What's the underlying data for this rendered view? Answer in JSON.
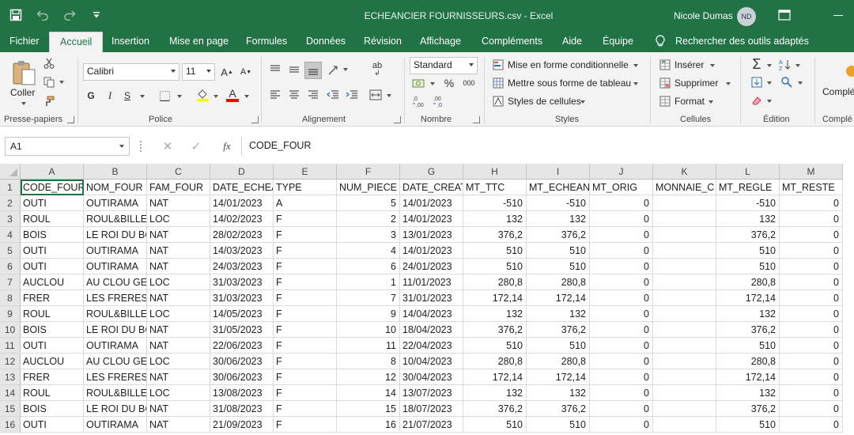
{
  "window": {
    "title": "ECHEANCIER FOURNISSEURS.csv  -  Excel",
    "user_name": "Nicole Dumas",
    "user_initials": "ND"
  },
  "ribbon_tabs": [
    "Fichier",
    "Accueil",
    "Insertion",
    "Mise en page",
    "Formules",
    "Données",
    "Révision",
    "Affichage",
    "Compléments",
    "Aide",
    "Équipe"
  ],
  "active_tab": "Accueil",
  "tell_me": "Rechercher des outils adaptés",
  "ribbon": {
    "clipboard": {
      "paste": "Coller",
      "label": "Presse-papiers"
    },
    "font": {
      "name": "Calibri",
      "size": "11",
      "bold": "G",
      "italic": "I",
      "underline": "S",
      "grow": "A",
      "shrink": "A",
      "fill_letter": "A",
      "label": "Police"
    },
    "alignment": {
      "label": "Alignement",
      "wrap": "ab"
    },
    "number": {
      "format": "Standard",
      "percent": "%",
      "thousands": "000",
      "inc_dec": ",0→,00",
      "dec_dec": ",00→,0",
      "label": "Nombre"
    },
    "styles": {
      "conditional": "Mise en forme conditionnelle",
      "table": "Mettre sous forme de tableau",
      "cell_styles": "Styles de cellules",
      "label": "Styles"
    },
    "cells": {
      "insert": "Insérer",
      "delete": "Supprimer",
      "format": "Format",
      "label": "Cellules"
    },
    "editing": {
      "sigma": "Σ",
      "label": "Édition"
    },
    "addins": {
      "label_top": "Complé",
      "label_bottom": "Complé"
    }
  },
  "formula_bar": {
    "name_box": "A1",
    "fx": "fx",
    "content": "CODE_FOUR"
  },
  "sheet": {
    "columns": [
      "A",
      "B",
      "C",
      "D",
      "E",
      "F",
      "G",
      "H",
      "I",
      "J",
      "K",
      "L",
      "M"
    ],
    "rows": [
      [
        "CODE_FOUR",
        "NOM_FOUR",
        "FAM_FOUR",
        "DATE_ECHEA",
        "TYPE",
        "NUM_PIECE",
        "DATE_CREAT",
        "MT_TTC",
        "MT_ECHEAN",
        "MT_ORIG",
        "MONNAIE_C",
        "MT_REGLE",
        "MT_RESTE"
      ],
      [
        "OUTI",
        "OUTIRAMA",
        "NAT",
        "14/01/2023",
        "A",
        "5",
        "14/01/2023",
        "-510",
        "-510",
        "0",
        "",
        "-510",
        "0"
      ],
      [
        "ROUL",
        "ROUL&BILLE",
        "LOC",
        "14/02/2023",
        "F",
        "2",
        "14/01/2023",
        "132",
        "132",
        "0",
        "",
        "132",
        "0"
      ],
      [
        "BOIS",
        "LE ROI DU BC",
        "NAT",
        "28/02/2023",
        "F",
        "3",
        "13/01/2023",
        "376,2",
        "376,2",
        "0",
        "",
        "376,2",
        "0"
      ],
      [
        "OUTI",
        "OUTIRAMA",
        "NAT",
        "14/03/2023",
        "F",
        "4",
        "14/01/2023",
        "510",
        "510",
        "0",
        "",
        "510",
        "0"
      ],
      [
        "OUTI",
        "OUTIRAMA",
        "NAT",
        "24/03/2023",
        "F",
        "6",
        "24/01/2023",
        "510",
        "510",
        "0",
        "",
        "510",
        "0"
      ],
      [
        "AUCLOU",
        "AU CLOU GEA",
        "LOC",
        "31/03/2023",
        "F",
        "1",
        "11/01/2023",
        "280,8",
        "280,8",
        "0",
        "",
        "280,8",
        "0"
      ],
      [
        "FRER",
        "LES FRERES L",
        "NAT",
        "31/03/2023",
        "F",
        "7",
        "31/01/2023",
        "172,14",
        "172,14",
        "0",
        "",
        "172,14",
        "0"
      ],
      [
        "ROUL",
        "ROUL&BILLE",
        "LOC",
        "14/05/2023",
        "F",
        "9",
        "14/04/2023",
        "132",
        "132",
        "0",
        "",
        "132",
        "0"
      ],
      [
        "BOIS",
        "LE ROI DU BC",
        "NAT",
        "31/05/2023",
        "F",
        "10",
        "18/04/2023",
        "376,2",
        "376,2",
        "0",
        "",
        "376,2",
        "0"
      ],
      [
        "OUTI",
        "OUTIRAMA",
        "NAT",
        "22/06/2023",
        "F",
        "11",
        "22/04/2023",
        "510",
        "510",
        "0",
        "",
        "510",
        "0"
      ],
      [
        "AUCLOU",
        "AU CLOU GEA",
        "LOC",
        "30/06/2023",
        "F",
        "8",
        "10/04/2023",
        "280,8",
        "280,8",
        "0",
        "",
        "280,8",
        "0"
      ],
      [
        "FRER",
        "LES FRERES L",
        "NAT",
        "30/06/2023",
        "F",
        "12",
        "30/04/2023",
        "172,14",
        "172,14",
        "0",
        "",
        "172,14",
        "0"
      ],
      [
        "ROUL",
        "ROUL&BILLE",
        "LOC",
        "13/08/2023",
        "F",
        "14",
        "13/07/2023",
        "132",
        "132",
        "0",
        "",
        "132",
        "0"
      ],
      [
        "BOIS",
        "LE ROI DU BC",
        "NAT",
        "31/08/2023",
        "F",
        "15",
        "18/07/2023",
        "376,2",
        "376,2",
        "0",
        "",
        "376,2",
        "0"
      ],
      [
        "OUTI",
        "OUTIRAMA",
        "NAT",
        "21/09/2023",
        "F",
        "16",
        "21/07/2023",
        "510",
        "510",
        "0",
        "",
        "510",
        "0"
      ]
    ]
  }
}
